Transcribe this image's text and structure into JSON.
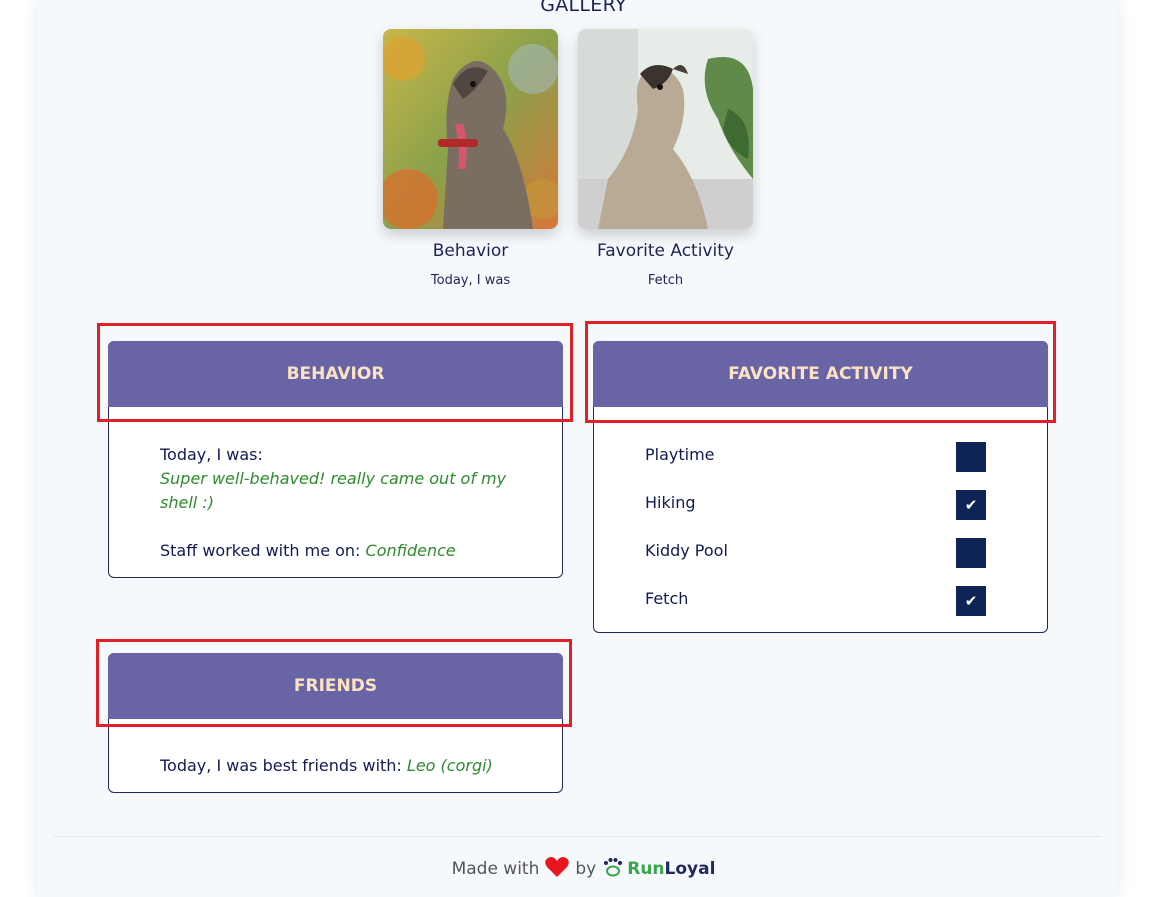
{
  "gallery": {
    "title": "GALLERY",
    "items": [
      {
        "title": "Behavior",
        "subtitle": "Today, I was"
      },
      {
        "title": "Favorite Activity",
        "subtitle": "Fetch"
      }
    ]
  },
  "behavior": {
    "header": "BEHAVIOR",
    "today_label": "Today, I was:",
    "today_value_line1": "Super well-behaved! really came out of my",
    "today_value_line2": "shell :)",
    "staff_label": "Staff worked with me on: ",
    "staff_value": "Confidence"
  },
  "favorite_activity": {
    "header": "FAVORITE ACTIVITY",
    "items": [
      {
        "label": "Playtime",
        "checked": false
      },
      {
        "label": "Hiking",
        "checked": true
      },
      {
        "label": "Kiddy Pool",
        "checked": false
      },
      {
        "label": "Fetch",
        "checked": true
      }
    ]
  },
  "friends": {
    "header": "FRIENDS",
    "label": "Today, I was best friends with: ",
    "value": "Leo (corgi)"
  },
  "footer": {
    "made_with": "Made with",
    "by": "by",
    "brand_run": "Run",
    "brand_loyal": "Loyal"
  },
  "colors": {
    "header_bg": "#6864a6",
    "header_text": "#fbe3c2",
    "highlight": "#e01f26",
    "accent_green": "#2e8b2e",
    "checkbox": "#0e2456"
  }
}
